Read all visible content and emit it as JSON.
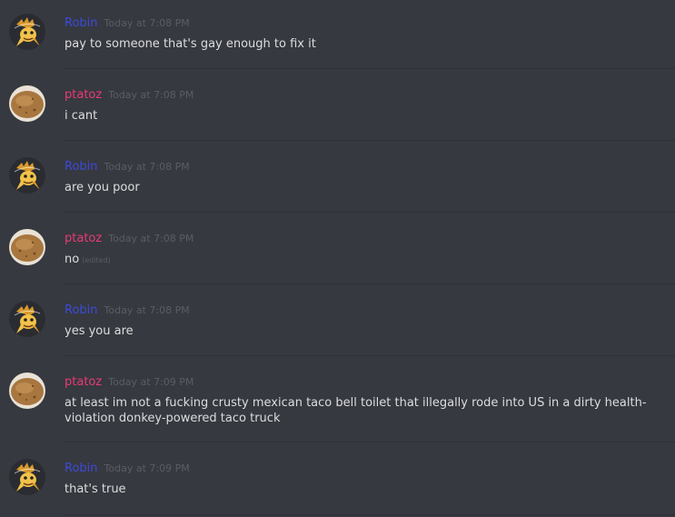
{
  "users": {
    "robin": {
      "name": "Robin",
      "color": "#3d4adb"
    },
    "ptatoz": {
      "name": "ptatoz",
      "color": "#e83a76"
    }
  },
  "messages": [
    {
      "author": "Robin",
      "timestamp": "Today at 7:08 PM",
      "text": "pay to someone that's gay enough to fix it"
    },
    {
      "author": "ptatoz",
      "timestamp": "Today at 7:08 PM",
      "text": "i cant"
    },
    {
      "author": "Robin",
      "timestamp": "Today at 7:08 PM",
      "text": "are you poor"
    },
    {
      "author": "ptatoz",
      "timestamp": "Today at 7:08 PM",
      "text": "no",
      "edited_label": "(edited)"
    },
    {
      "author": "Robin",
      "timestamp": "Today at 7:08 PM",
      "text": "yes you are"
    },
    {
      "author": "ptatoz",
      "timestamp": "Today at 7:09 PM",
      "text": "at least im not a fucking crusty mexican taco bell toilet that illegally rode into US in a dirty health-violation donkey-powered taco truck"
    },
    {
      "author": "Robin",
      "timestamp": "Today at 7:09 PM",
      "text": "that's true"
    }
  ]
}
